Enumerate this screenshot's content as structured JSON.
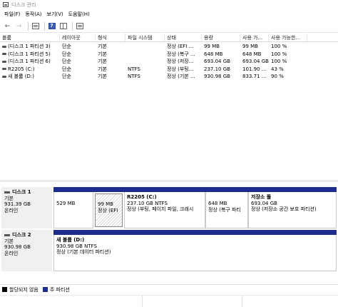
{
  "window": {
    "title": "디스크 관리"
  },
  "menu": [
    "파일(F)",
    "동작(A)",
    "보기(V)",
    "도움말(H)"
  ],
  "colors": {
    "primary_partition": "#1c2d8c",
    "unallocated": "#000000"
  },
  "columns": [
    "볼륨",
    "레이아웃",
    "형식",
    "파일 시스템",
    "상태",
    "용량",
    "사용 가...",
    "사용 가능한..."
  ],
  "volumes": [
    {
      "name": "(디스크 1 파티션 3)",
      "layout": "단순",
      "type": "기본",
      "fs": "",
      "status": "정상 (EFI ...",
      "capacity": "99 MB",
      "free": "99 MB",
      "pct": "100 %"
    },
    {
      "name": "(디스크 1 파티션 5)",
      "layout": "단순",
      "type": "기본",
      "fs": "",
      "status": "정상 (복구 ...",
      "capacity": "648 MB",
      "free": "648 MB",
      "pct": "100 %"
    },
    {
      "name": "(디스크 1 파티션 6)",
      "layout": "단순",
      "type": "기본",
      "fs": "",
      "status": "정상 (저장...",
      "capacity": "693.04 GB",
      "free": "693.04 GB",
      "pct": "100 %"
    },
    {
      "name": "R2205 (C:)",
      "layout": "단순",
      "type": "기본",
      "fs": "NTFS",
      "status": "정상 (부팅...",
      "capacity": "237.10 GB",
      "free": "101.90 ...",
      "pct": "43 %"
    },
    {
      "name": "새 볼륨 (D:)",
      "layout": "단순",
      "type": "기본",
      "fs": "NTFS",
      "status": "정상 (기본 ...",
      "capacity": "930.98 GB",
      "free": "833.71 ...",
      "pct": "90 %"
    }
  ],
  "disks": [
    {
      "name": "디스크 1",
      "type": "기본",
      "size": "931.39 GB",
      "state": "온라인",
      "partitions": [
        {
          "line1": "529 MB",
          "line2": "",
          "line3": ""
        },
        {
          "line1": "99 MB",
          "line2": "정상 (EFI",
          "line3": ""
        },
        {
          "name": "R2205  (C:)",
          "line1": "237.10 GB NTFS",
          "line2": "정상 (부팅, 페이지 파일, 크래시"
        },
        {
          "line1": "648 MB",
          "line2": "정상 (복구 파티"
        },
        {
          "name": "저장소 풀",
          "line1": "693.04 GB",
          "line2": "정상 (저장소 공간 보호 파티션)"
        }
      ]
    },
    {
      "name": "디스크 2",
      "type": "기본",
      "size": "930.98 GB",
      "state": "온라인",
      "partitions": [
        {
          "name": "새 볼륨  (D:)",
          "line1": "930.98 GB NTFS",
          "line2": "정상 (기본 데이터 파티션)"
        }
      ]
    }
  ],
  "legend": [
    {
      "label": "할당되지 않음",
      "color": "#000000"
    },
    {
      "label": "주 파티션",
      "color": "#1c2d8c"
    }
  ]
}
